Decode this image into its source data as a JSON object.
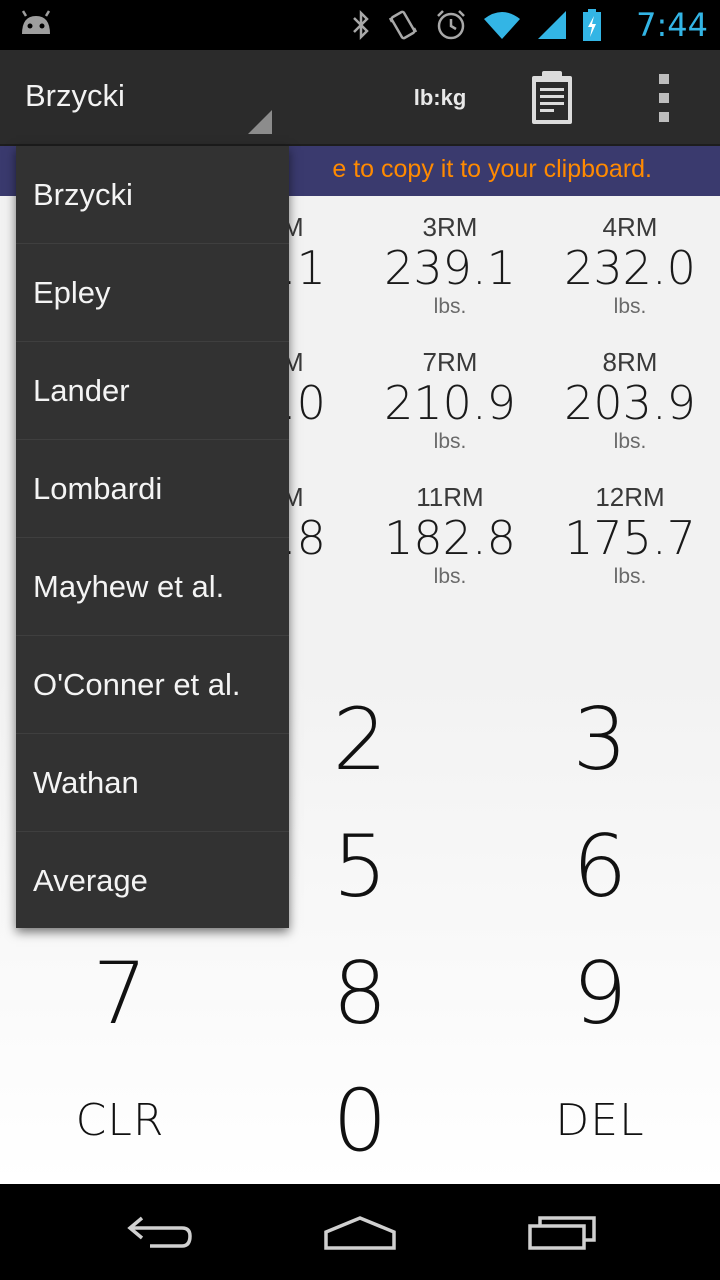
{
  "status_bar": {
    "time": "7:44",
    "icons": [
      "android-icon",
      "bluetooth-icon",
      "vibrate-icon",
      "alarm-icon",
      "wifi-icon",
      "signal-icon",
      "battery-charging-icon"
    ]
  },
  "action_bar": {
    "spinner_label": "Brzycki",
    "unit_toggle": "lb:kg",
    "icons": [
      "clipboard-icon",
      "overflow-menu-icon"
    ]
  },
  "banner": {
    "text": "e to copy it to your clipboard."
  },
  "results": [
    {
      "rm": "M",
      "value": ".1",
      "unit": ""
    },
    {
      "rm": "3RM",
      "value": "239.1",
      "unit": "lbs."
    },
    {
      "rm": "4RM",
      "value": "232.0",
      "unit": "lbs."
    },
    {
      "rm": "M",
      "value": ".0",
      "unit": ""
    },
    {
      "rm": "7RM",
      "value": "210.9",
      "unit": "lbs."
    },
    {
      "rm": "8RM",
      "value": "203.9",
      "unit": "lbs."
    },
    {
      "rm": "M",
      "value": ".8",
      "unit": ""
    },
    {
      "rm": "11RM",
      "value": "182.8",
      "unit": "lbs."
    },
    {
      "rm": "12RM",
      "value": "175.7",
      "unit": "lbs."
    }
  ],
  "keypad": {
    "k2": "2",
    "k3": "3",
    "k5": "5",
    "k6": "6",
    "k7": "7",
    "k8": "8",
    "k9": "9",
    "clr": "CLR",
    "k0": "0",
    "del": "DEL"
  },
  "dropdown": {
    "items": [
      "Brzycki",
      "Epley",
      "Lander",
      "Lombardi",
      "Mayhew et al.",
      "O'Conner et al.",
      "Wathan",
      "Average"
    ]
  },
  "nav_bar": {
    "icons": [
      "back-icon",
      "home-icon",
      "recents-icon"
    ]
  },
  "colors": {
    "status_time": "#33b5e5",
    "banner_bg": "#3a3a6e",
    "banner_text": "#ff8a00",
    "action_bar_bg": "#2b2b2b",
    "dropdown_bg": "#323232"
  }
}
